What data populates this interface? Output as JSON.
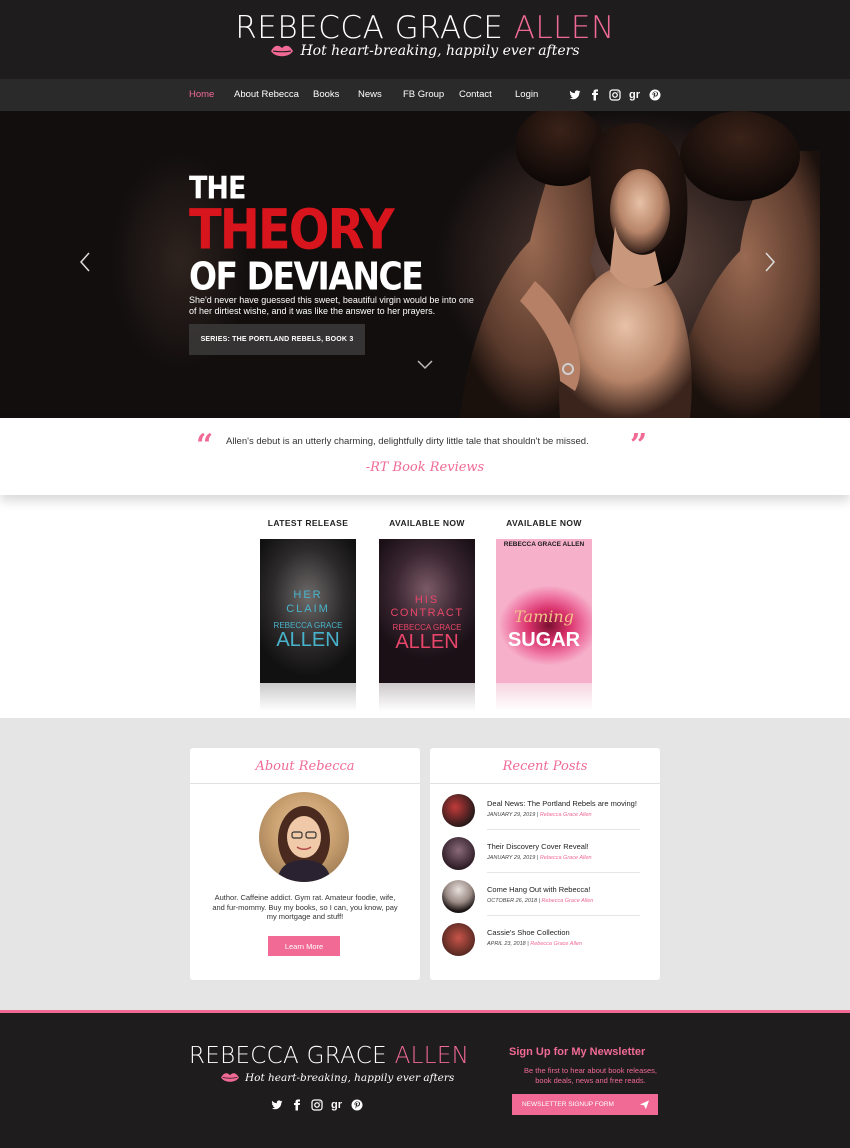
{
  "header": {
    "brand_main": "REBECCA GRACE ",
    "brand_accent": "ALLEN",
    "tagline": "Hot heart-breaking, happily ever afters"
  },
  "nav": {
    "items": [
      {
        "label": "Home",
        "active": true
      },
      {
        "label": "About Rebecca"
      },
      {
        "label": "Books"
      },
      {
        "label": "News"
      },
      {
        "label": "FB Group"
      },
      {
        "label": "Contact"
      },
      {
        "label": "Login"
      }
    ],
    "social": [
      "twitter-icon",
      "facebook-icon",
      "instagram-icon",
      "goodreads-icon",
      "pinterest-icon"
    ],
    "goodreads_label": "gr"
  },
  "hero": {
    "title_line1": "THE",
    "title_line2": "THEORY",
    "title_line3": "OF DEVIANCE",
    "blurb": "She'd never have guessed this sweet, beautiful virgin would be into one of  her dirtiest wishe, and it was like the answer to her prayers.",
    "series_button": "SERIES: THE PORTLAND REBELS, BOOK 3"
  },
  "quote": {
    "text": "Allen's debut is an utterly charming, delightfully dirty little tale that shouldn't be missed.",
    "source": "-RT Book Reviews"
  },
  "books": [
    {
      "label": "LATEST RELEASE",
      "title_a": "HER",
      "title_b": "CLAIM",
      "author_a": "REBECCA GRACE",
      "author_b": "ALLEN"
    },
    {
      "label": "AVAILABLE NOW",
      "title_a": "HIS",
      "title_b": "CONTRACT",
      "author_a": "REBECCA GRACE",
      "author_b": "ALLEN"
    },
    {
      "label": "AVAILABLE NOW",
      "author_top": "REBECCA GRACE ALLEN",
      "title_a": "Taming",
      "title_b": "SUGAR"
    }
  ],
  "about": {
    "title": "About Rebecca",
    "text": "Author. Caffeine addict. Gym rat. Amateur foodie, wife, and fur-mommy. Buy my books, so I can, you know, pay my mortgage and stuff!",
    "button": "Learn More"
  },
  "recent": {
    "title": "Recent Posts",
    "posts": [
      {
        "title": "Deal News: The Portland Rebels are moving!",
        "date": "JANUARY 29, 2019",
        "author": "Rebecca Grace Allen"
      },
      {
        "title": "Their Discovery Cover Reveal!",
        "date": "JANUARY 29, 2019",
        "author": "Rebecca Grace Allen"
      },
      {
        "title": "Come Hang Out with Rebecca!",
        "date": "OCTOBER 26, 2018",
        "author": "Rebecca Grace Allen"
      },
      {
        "title": "Cassie's Shoe Collection",
        "date": "APRIL 23, 2018",
        "author": "Rebecca Grace Allen"
      }
    ],
    "separator": " | "
  },
  "footer": {
    "brand_main": "REBECCA GRACE ",
    "brand_accent": "ALLEN",
    "tagline": "Hot heart-breaking, happily ever afters",
    "newsletter_title": "Sign Up for My Newsletter",
    "newsletter_text": "Be the first to hear about book releases, book deals, news and free reads.",
    "newsletter_button": "NEWSLETTER SIGNUP FORM"
  },
  "colors": {
    "accent": "#f06a95",
    "dark": "#1e1c1d",
    "hero_red": "#d8141c"
  }
}
